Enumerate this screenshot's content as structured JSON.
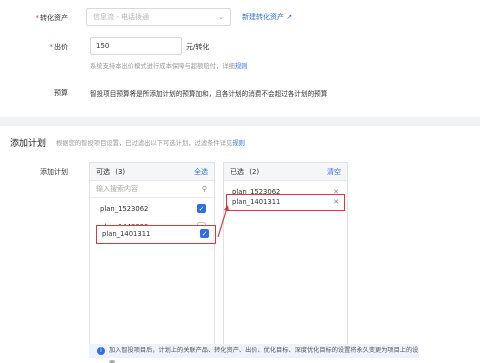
{
  "conversion": {
    "label": "转化资产",
    "required_mark": "*",
    "select_placeholder": "信息流 - 电话拨通",
    "new_link": "新建转化资产"
  },
  "bid": {
    "label": "出价",
    "value": "150",
    "unit": "元/转化",
    "hint": "系统支持本出价模式进行成本保障与超额赔付，详细",
    "hint_link": "规则"
  },
  "budget": {
    "label": "预算",
    "text": "智投项目预算将是所添加计划的预算加和，且各计划的消费不会超过各计划的预算"
  },
  "add_plan_section": {
    "title": "添加计划",
    "desc": "根据您的智投项目设置，已过滤出以下可选计划，过滤条件详见",
    "desc_link": "规则",
    "field_label": "添加计划"
  },
  "available": {
    "title": "可选",
    "count": "(3)",
    "select_all": "全选",
    "search_placeholder": "输入搜索内容",
    "items": [
      {
        "name": "plan_1523062",
        "checked": true
      },
      {
        "name": "plan_1448899",
        "checked": false
      },
      {
        "name": "plan_1401311",
        "checked": true
      }
    ]
  },
  "selected": {
    "title": "已选",
    "count": "(2)",
    "clear": "清空",
    "items": [
      {
        "name": "plan_1523062"
      },
      {
        "name": "plan_1401311"
      }
    ]
  },
  "notice": {
    "text": "加入智投项目后，计划上的关联产品、转化资产、出价、优化目标、深度优化目标的设置将永久变更为项目上的设置"
  },
  "colors": {
    "accent": "#2f6fe4",
    "highlight": "#e0353d"
  }
}
